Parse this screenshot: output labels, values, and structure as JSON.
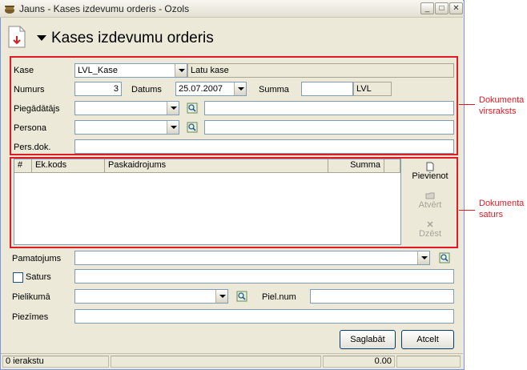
{
  "window": {
    "title": "Jauns - Kases izdevumu orderis - Ozols",
    "minimize_glyph": "_",
    "maximize_glyph": "□",
    "close_glyph": "✕"
  },
  "header": {
    "title": "Kases izdevumu orderis"
  },
  "form": {
    "kase_label": "Kase",
    "kase_value": "LVL_Kase",
    "kase_name": "Latu kase",
    "numurs_label": "Numurs",
    "numurs_value": "3",
    "datums_label": "Datums",
    "datums_value": "25.07.2007",
    "summa_label": "Summa",
    "summa_value": "",
    "currency": "LVL",
    "piegadatajs_label": "Piegādātājs",
    "piegadatajs_value": "",
    "piegadatajs_name": "",
    "persona_label": "Persona",
    "persona_value": "",
    "persona_name": "",
    "persdok_label": "Pers.dok.",
    "persdok_value": ""
  },
  "grid": {
    "columns": [
      "#",
      "Ek.kods",
      "Paskaidrojums",
      "Summa"
    ]
  },
  "side_buttons": {
    "add": "Pievienot",
    "open": "Atvērt",
    "delete": "Dzēst"
  },
  "lower": {
    "pamatojums_label": "Pamatojums",
    "pamatojums_value": "",
    "saturs_label": "Saturs",
    "saturs_value": "",
    "pielikuma_label": "Pielikumā",
    "pielikuma_value": "",
    "pielnum_label": "Piel.num",
    "pielnum_value": "",
    "piezimes_label": "Piezīmes",
    "piezimes_value": ""
  },
  "buttons": {
    "save": "Saglabāt",
    "cancel": "Atcelt"
  },
  "status": {
    "records": "0 ierakstu",
    "total": "0.00"
  },
  "annotations": {
    "header_line1": "Dokumenta",
    "header_line2": "virsraksts",
    "content_line1": "Dokumenta",
    "content_line2": "saturs"
  },
  "colors": {
    "annotation": "#e01b24",
    "window_bg": "#ece9d8"
  }
}
